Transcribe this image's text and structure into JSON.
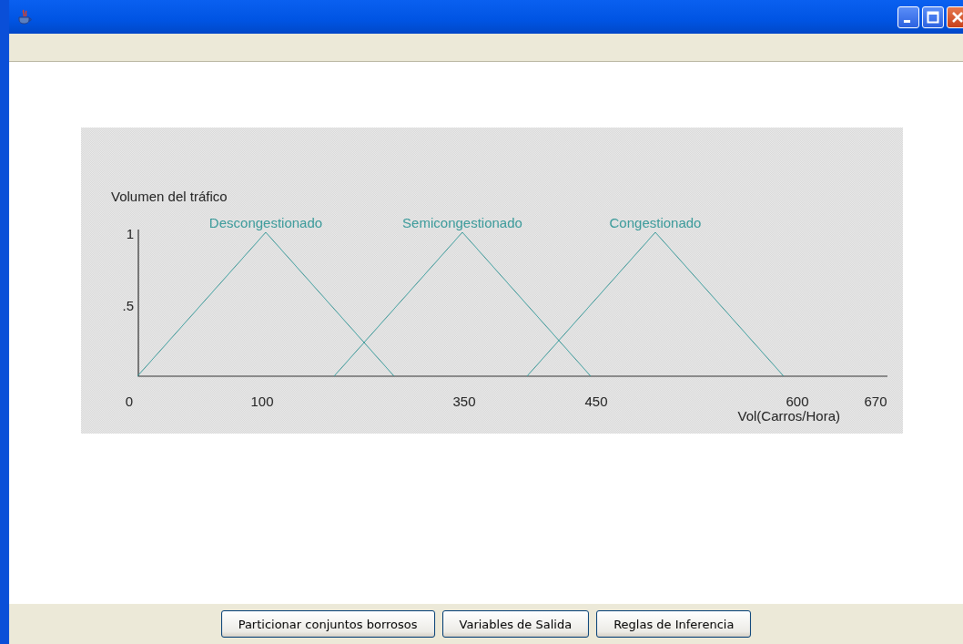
{
  "graph": {
    "ylabel": "Volumen del tráfico",
    "xlabel": "Vol(Carros/Hora)",
    "y_tick_labels": [
      "1",
      ".5"
    ],
    "x_tick_labels": [
      "0",
      "100",
      "350",
      "450",
      "600",
      "670"
    ],
    "sets": [
      {
        "name": "Descongestionado"
      },
      {
        "name": "Semicongestionado"
      },
      {
        "name": "Congestionado"
      }
    ]
  },
  "buttons": [
    "Particionar conjuntos borrosos",
    "Variables de Salida",
    "Reglas de Inferencia"
  ]
}
